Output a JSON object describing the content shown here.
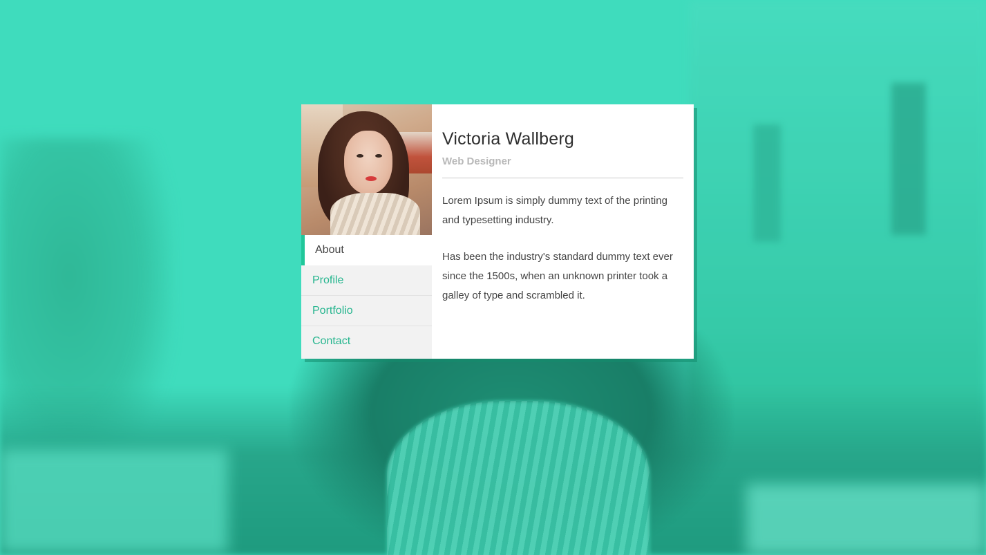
{
  "profile": {
    "name": "Victoria Wallberg",
    "role": "Web Designer",
    "paragraphs": [
      "Lorem Ipsum is simply dummy text of the printing and typesetting industry.",
      "Has been the industry's standard dummy text ever since the 1500s, when an unknown printer took a galley of type and scrambled it."
    ]
  },
  "nav": {
    "items": [
      {
        "label": "About",
        "active": true
      },
      {
        "label": "Profile",
        "active": false
      },
      {
        "label": "Portfolio",
        "active": false
      },
      {
        "label": "Contact",
        "active": false
      }
    ]
  },
  "colors": {
    "accent": "#20c79a",
    "background_tint": "#3fdcbd",
    "nav_link": "#25b58e",
    "role_text": "#b8b8b8"
  }
}
